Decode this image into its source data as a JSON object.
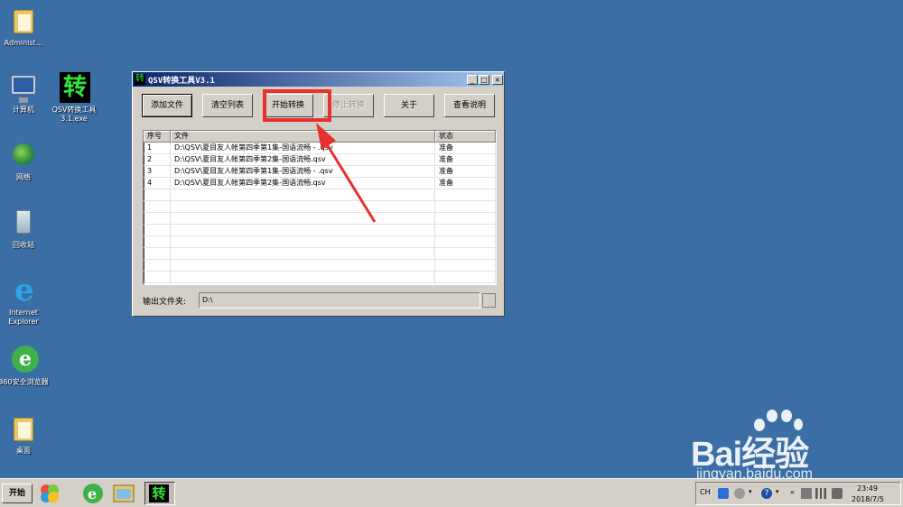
{
  "desktop": {
    "icons": [
      {
        "label": "Administ..."
      },
      {
        "label": "计算机"
      },
      {
        "label": "QSV转换工具\n3.1.exe"
      },
      {
        "label": "网络"
      },
      {
        "label": "回收站"
      },
      {
        "label": "Internet\nExplorer"
      },
      {
        "label": "360安全浏览器"
      },
      {
        "label": "桌面"
      }
    ],
    "app_glyph": "转"
  },
  "window": {
    "title": "QSV转换工具V3.1",
    "controls": {
      "minimize": "_",
      "maximize": "□",
      "close": "×"
    },
    "buttons": {
      "add_file": "添加文件",
      "clear_list": "清空列表",
      "start_convert": "开始转换",
      "stop_convert": "停止转换",
      "about": "关于",
      "view_help": "查看说明"
    },
    "list": {
      "headers": [
        "序号",
        "文件",
        "状态"
      ],
      "rows": [
        [
          "1",
          "D:\\QSV\\夏目友人帐第四季第1集-国语流畅 - .qsv",
          "准备"
        ],
        [
          "2",
          "D:\\QSV\\夏目友人帐第四季第2集-国语流畅.qsv",
          "准备"
        ],
        [
          "3",
          "D:\\QSV\\夏目友人帐第四季第1集-国语流畅 - .qsv",
          "准备"
        ],
        [
          "4",
          "D:\\QSV\\夏目友人帐第四季第2集-国语流畅.qsv",
          "准备"
        ]
      ]
    },
    "output": {
      "label": "输出文件夹:",
      "value": "D:\\"
    }
  },
  "watermark": {
    "main": "Bai经验",
    "sub": "jingyan.baidu.com"
  },
  "taskbar": {
    "start_label": "开始",
    "app_glyph": "转",
    "tray": {
      "lang": "CH",
      "time": "23:49",
      "date": "2018/7/5"
    }
  },
  "colors": {
    "desktop": "#3a6ea5",
    "highlight": "#e8302f",
    "titlebar": "#0a246a"
  }
}
